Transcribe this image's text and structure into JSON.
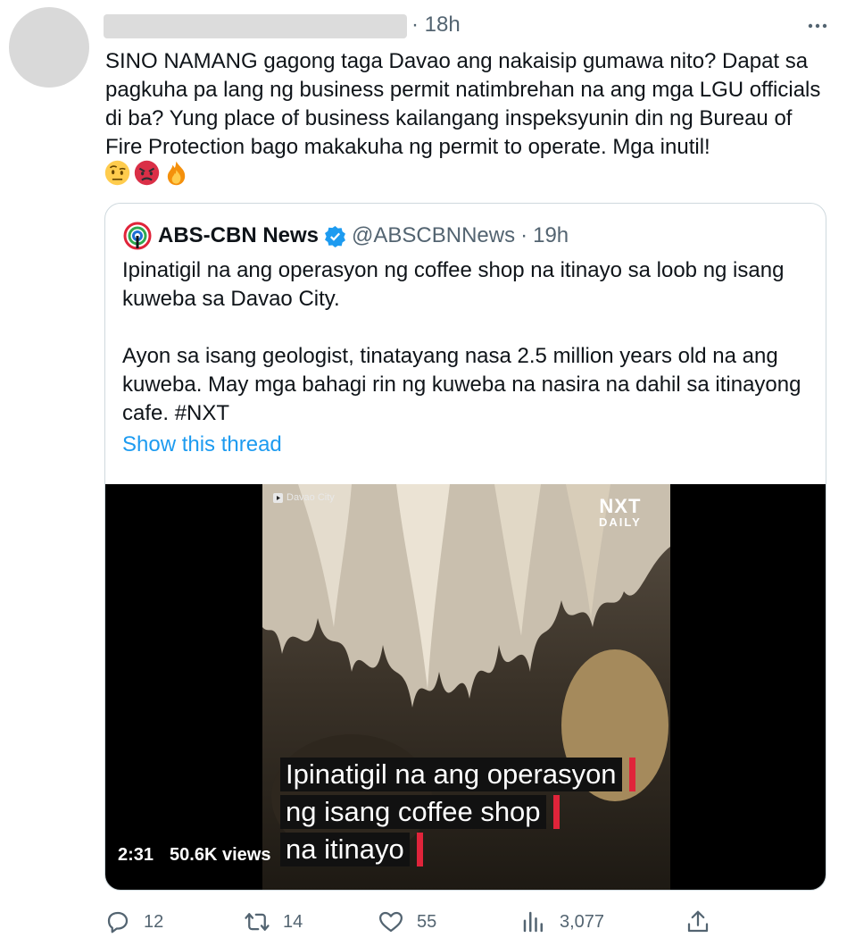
{
  "tweet": {
    "time_label": "· 18h",
    "text": "SINO NAMANG gagong taga Davao ang nakaisip gumawa nito? Dapat sa pagkuha pa lang ng business permit natimbrehan na ang mga LGU officials di ba? Yung place of business kailangang inspeksyunin din ng Bureau of Fire Protection bago makakuha ng permit to operate. Mga inutil!",
    "emojis": [
      "face-with-raised-eyebrow-emoji",
      "angry-face-emoji",
      "fire-emoji"
    ]
  },
  "quote": {
    "name": "ABS-CBN News",
    "handle": "@ABSCBNNews",
    "dot": "·",
    "time": "19h",
    "paragraph1": "Ipinatigil na ang operasyon ng coffee shop na itinayo sa loob ng isang kuweba sa Davao City.",
    "paragraph2": "Ayon sa isang geologist, tinatayang nasa 2.5 million years old na ang kuweba. May mga bahagi rin ng kuweba na nasira na dahil sa itinayong cafe. #NXT",
    "show_thread": "Show this thread",
    "video": {
      "location": "Davao City",
      "brand_main": "NXT",
      "brand_sub": "DAILY",
      "caption_lines": [
        "Ipinatigil na ang operasyon",
        "ng isang coffee shop",
        "na itinayo"
      ],
      "duration": "2:31",
      "views": "50.6K views"
    }
  },
  "actions": {
    "replies": "12",
    "retweets": "14",
    "likes": "55",
    "views": "3,077"
  },
  "colors": {
    "link": "#1d9bf0",
    "muted": "#536471",
    "verified": "#1d9bf0",
    "caption_bar": "#e0243a"
  }
}
